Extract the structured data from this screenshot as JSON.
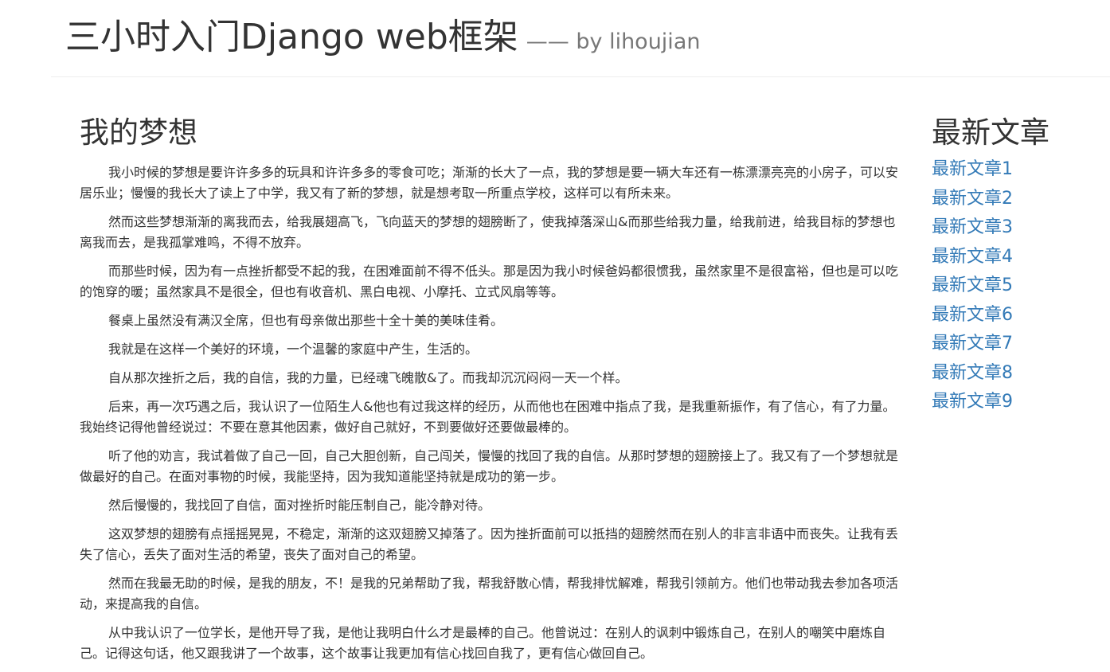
{
  "header": {
    "title": "三小时入门Django web框架",
    "subtitle": "—— by lihoujian"
  },
  "article": {
    "title": "我的梦想",
    "paragraphs": [
      "我小时候的梦想是要许许多多的玩具和许许多多的零食可吃；渐渐的长大了一点，我的梦想是要一辆大车还有一栋漂漂亮亮的小房子，可以安居乐业；慢慢的我长大了读上了中学，我又有了新的梦想，就是想考取一所重点学校，这样可以有所未来。",
      "然而这些梦想渐渐的离我而去，给我展翅高飞，飞向蓝天的梦想的翅膀断了，使我掉落深山&而那些给我力量，给我前进，给我目标的梦想也离我而去，是我孤掌难鸣，不得不放弃。",
      "而那些时候，因为有一点挫折都受不起的我，在困难面前不得不低头。那是因为我小时候爸妈都很惯我，虽然家里不是很富裕，但也是可以吃的饱穿的暖；虽然家具不是很全，但也有收音机、黑白电视、小摩托、立式风扇等等。",
      "餐桌上虽然没有满汉全席，但也有母亲做出那些十全十美的美味佳肴。",
      "我就是在这样一个美好的环境，一个温馨的家庭中产生，生活的。",
      "自从那次挫折之后，我的自信，我的力量，已经魂飞魄散&了。而我却沉沉闷闷一天一个样。",
      "后来，再一次巧遇之后，我认识了一位陌生人&他也有过我这样的经历，从而他也在困难中指点了我，是我重新振作，有了信心，有了力量。我始终记得他曾经说过：不要在意其他因素，做好自己就好，不到要做好还要做最棒的。",
      "听了他的劝言，我试着做了自己一回，自己大胆创新，自己闯关，慢慢的找回了我的自信。从那时梦想的翅膀接上了。我又有了一个梦想就是做最好的自己。在面对事物的时候，我能坚持，因为我知道能坚持就是成功的第一步。",
      "然后慢慢的，我找回了自信，面对挫折时能压制自己，能冷静对待。",
      "这双梦想的翅膀有点摇摇晃晃，不稳定，渐渐的这双翅膀又掉落了。因为挫折面前可以抵挡的翅膀然而在别人的非言非语中而丧失。让我有丢失了信心，丢失了面对生活的希望，丧失了面对自己的希望。",
      "然而在我最无助的时候，是我的朋友，不！是我的兄弟帮助了我，帮我舒散心情，帮我排忧解难，帮我引领前方。他们也带动我去参加各项活动，来提高我的自信。",
      "从中我认识了一位学长，是他开导了我，是他让我明白什么才是最棒的自己。他曾说过：在别人的讽刺中锻炼自己，在别人的嘲笑中磨炼自己。记得这句话，他又跟我讲了一个故事，这个故事让我更加有信心找回自我了，更有信心做回自己。"
    ]
  },
  "sidebar": {
    "title": "最新文章",
    "links": [
      "最新文章1",
      "最新文章2",
      "最新文章3",
      "最新文章4",
      "最新文章5",
      "最新文章6",
      "最新文章7",
      "最新文章8",
      "最新文章9"
    ]
  },
  "colors": {
    "link": "#337ab7",
    "text": "#333333",
    "subtitle": "#777777"
  }
}
